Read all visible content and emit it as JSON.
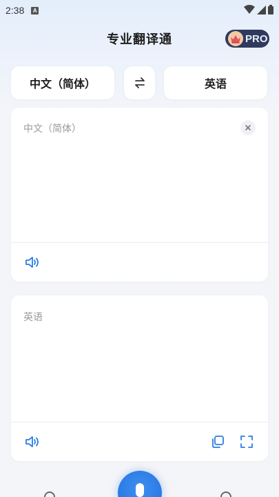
{
  "status_bar": {
    "time": "2:38",
    "notification_glyph": "A"
  },
  "header": {
    "title": "专业翻译通",
    "pro_label": "PRO"
  },
  "language_selector": {
    "source_language": "中文（简体）",
    "target_language": "英语",
    "swap_icon": "swap-arrows-icon"
  },
  "source_panel": {
    "placeholder": "中文（简体）",
    "clear_icon": "close-icon",
    "speaker_icon": "speaker-icon"
  },
  "target_panel": {
    "label": "英语",
    "speaker_icon": "speaker-icon",
    "copy_icon": "copy-icon",
    "fullscreen_icon": "fullscreen-icon"
  },
  "bottom_bar": {
    "mic_icon": "microphone-icon"
  },
  "colors": {
    "accent": "#2a7de1",
    "pro_badge_bg": "#2f3a5e",
    "card_bg": "#ffffff",
    "placeholder": "#9a9a9a"
  }
}
